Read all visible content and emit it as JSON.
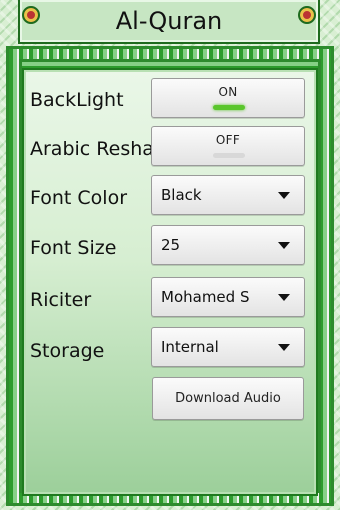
{
  "header": {
    "title": "Al-Quran"
  },
  "settings": {
    "backlight": {
      "label": "BackLight",
      "state": "ON"
    },
    "arabic_reshaping": {
      "label": "Arabic Reshaping",
      "state": "OFF"
    },
    "font_color": {
      "label": "Font Color",
      "value": "Black"
    },
    "font_size": {
      "label": "Font Size",
      "value": "25"
    },
    "reciter": {
      "label": "Riciter",
      "value": "Mohamed S"
    },
    "storage": {
      "label": "Storage",
      "value": "Internal"
    },
    "download_audio": {
      "label": "Download Audio"
    }
  },
  "icons": {
    "dropdown": "chevron-down-icon",
    "corner_ornament": "ornament-icon"
  },
  "colors": {
    "frame_green": "#2d8b2d",
    "toggle_on": "#5ac62c",
    "toggle_off": "#d8d8d8"
  }
}
